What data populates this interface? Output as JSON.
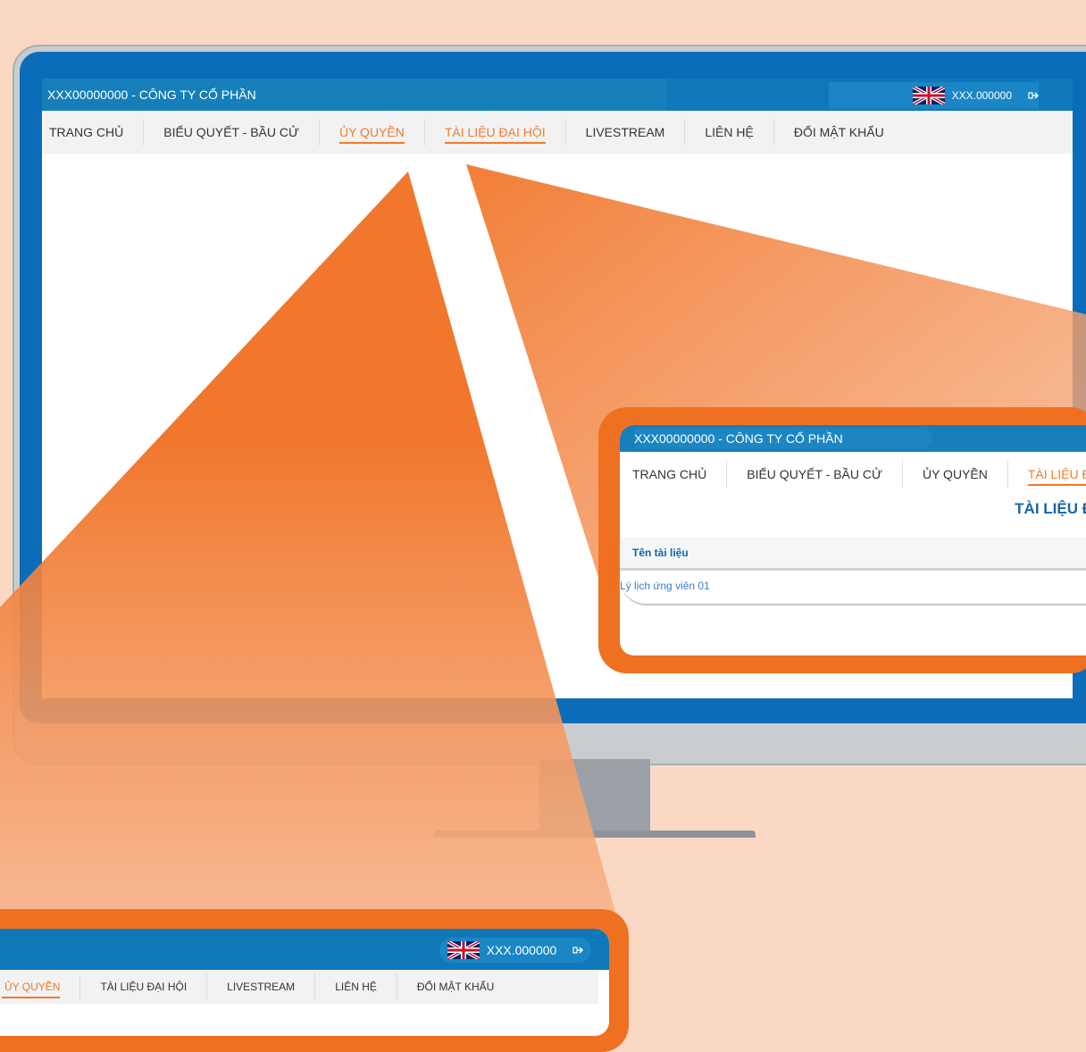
{
  "company": "XXX00000000 - CÔNG TY CỔ PHẦN",
  "account": "XXX.000000",
  "nav": [
    {
      "label": "TRANG CHỦ"
    },
    {
      "label": "BIỂU QUYẾT - BẦU CỬ"
    },
    {
      "label": "ỦY QUYỀN"
    },
    {
      "label": "TÀI LIỆU ĐẠI HỘI"
    },
    {
      "label": "LIVESTREAM"
    },
    {
      "label": "LIÊN HỆ"
    },
    {
      "label": "ĐỔI MẬT KHẨU"
    }
  ],
  "zoom_right": {
    "company": "XXX00000000 - CÔNG TY CỔ PHẦN",
    "nav": [
      "TRANG CHỦ",
      "BIỂU QUYẾT - BẦU CỬ",
      "ỦY QUYỀN",
      "TÀI LIỆU ĐẠI H"
    ],
    "page_title": "TÀI LIỆU Đ",
    "table_header": "Tên tài liệu",
    "rows": [
      "Lý lịch ứng viên 01"
    ]
  },
  "zoom_bottom": {
    "account": "XXX.000000",
    "nav": [
      "ỦY QUYỀN",
      "TÀI LIỆU ĐẠI HỘI",
      "LIVESTREAM",
      "LIÊN HỆ",
      "ĐỔI MẬT KHẨU"
    ]
  },
  "colors": {
    "background": "#fad8c4",
    "brand_blue": "#167fb9",
    "accent_orange": "#f07a2c",
    "bezel": "#0b6db9"
  },
  "icons": [
    "uk-flag-icon",
    "logout-icon"
  ]
}
